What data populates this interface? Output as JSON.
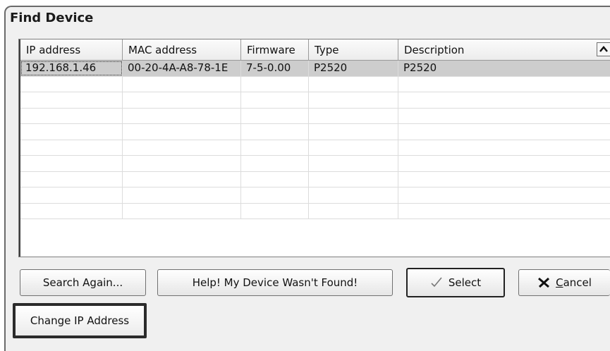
{
  "window": {
    "title": "Find Device"
  },
  "grid": {
    "columns": [
      "IP address",
      "MAC address",
      "Firmware",
      "Type",
      "Description"
    ],
    "rows": [
      [
        "192.168.1.46",
        "00-20-4A-A8-78-1E",
        "7-5-0.00",
        "P2520",
        "P2520"
      ]
    ],
    "empty_row_count": 9,
    "sort_icon": "chevron-up-icon"
  },
  "buttons": {
    "search_again": "Search Again...",
    "help_not_found": "Help! My Device Wasn't Found!",
    "select": "Select",
    "cancel_mnemonic": "C",
    "cancel_rest": "ancel",
    "change_ip": "Change IP Address"
  },
  "icons": {
    "select": "checkmark-icon",
    "cancel": "x-mark-icon"
  }
}
